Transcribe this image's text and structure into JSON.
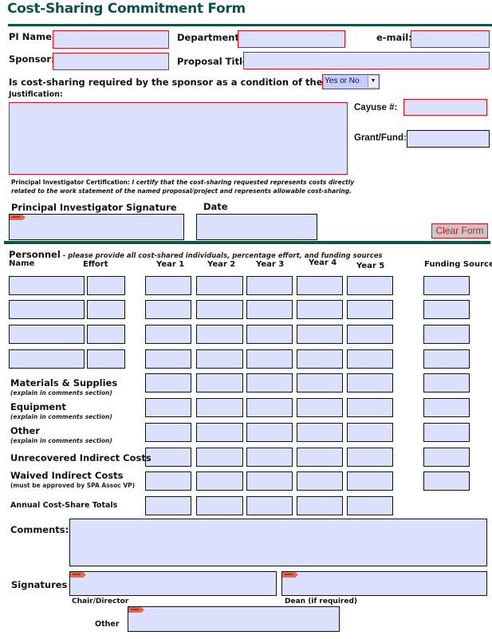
{
  "title": "Cost-Sharing Commitment Form",
  "header_fields": {
    "pi_name_label": "PI Name:",
    "department_label": "Department:",
    "email_label": "e-mail:",
    "sponsor_label": "Sponsor:",
    "proposal_title_label": "Proposal Title:",
    "question": "Is cost-sharing required by the sponsor as a condition of the award?",
    "question_select_value": "Yes or No",
    "justification_label": "Justification:",
    "cayuse_label": "Cayuse #:",
    "grant_fund_label": "Grant/Fund:",
    "pi_name_value": "",
    "department_value": "",
    "email_value": "",
    "sponsor_value": "",
    "proposal_title_value": "",
    "justification_value": "",
    "cayuse_value": "",
    "grant_fund_value": ""
  },
  "certification": {
    "label": "Principal Investigator Certification:",
    "line1": "I certify that the cost-sharing requested represents costs directly",
    "line2": "related to the work statement of the named proposal/project and represents allowable cost-sharing."
  },
  "pi_signature_label": "Principal Investigator Signature",
  "date_label": "Date",
  "clear_form_label": "Clear Form",
  "personnel": {
    "heading": "Personnel",
    "instruction": " - please provide all cost-shared individuals, percentage effort, and funding sources",
    "columns": [
      "Name",
      "Effort",
      "Year 1",
      "Year 2",
      "Year 3",
      "Year 4",
      "Year 5",
      "Funding Source"
    ],
    "row_count": 4
  },
  "cost_rows": [
    {
      "label": "Materials & Supplies",
      "note": "(explain in comments section)"
    },
    {
      "label": "Equipment",
      "note": "(explain in comments section)"
    },
    {
      "label": "Other",
      "note": "(explain in comments section)"
    },
    {
      "label": "Unrecovered Indirect Costs",
      "note": ""
    },
    {
      "label": "Waived Indirect Costs",
      "note": "(must be approved by SPA Assoc VP)"
    },
    {
      "label": "Annual Cost-Share Totals",
      "note": ""
    }
  ],
  "comments_label": "Comments:",
  "signatures": {
    "label": "Signatures",
    "chair_label": "Chair/Director",
    "dean_label": "Dean (if required)",
    "other_label": "Other"
  },
  "colors": {
    "accent": "#0f5249",
    "field_fill": "#dbe1fd",
    "required_border": "#e0101a"
  }
}
